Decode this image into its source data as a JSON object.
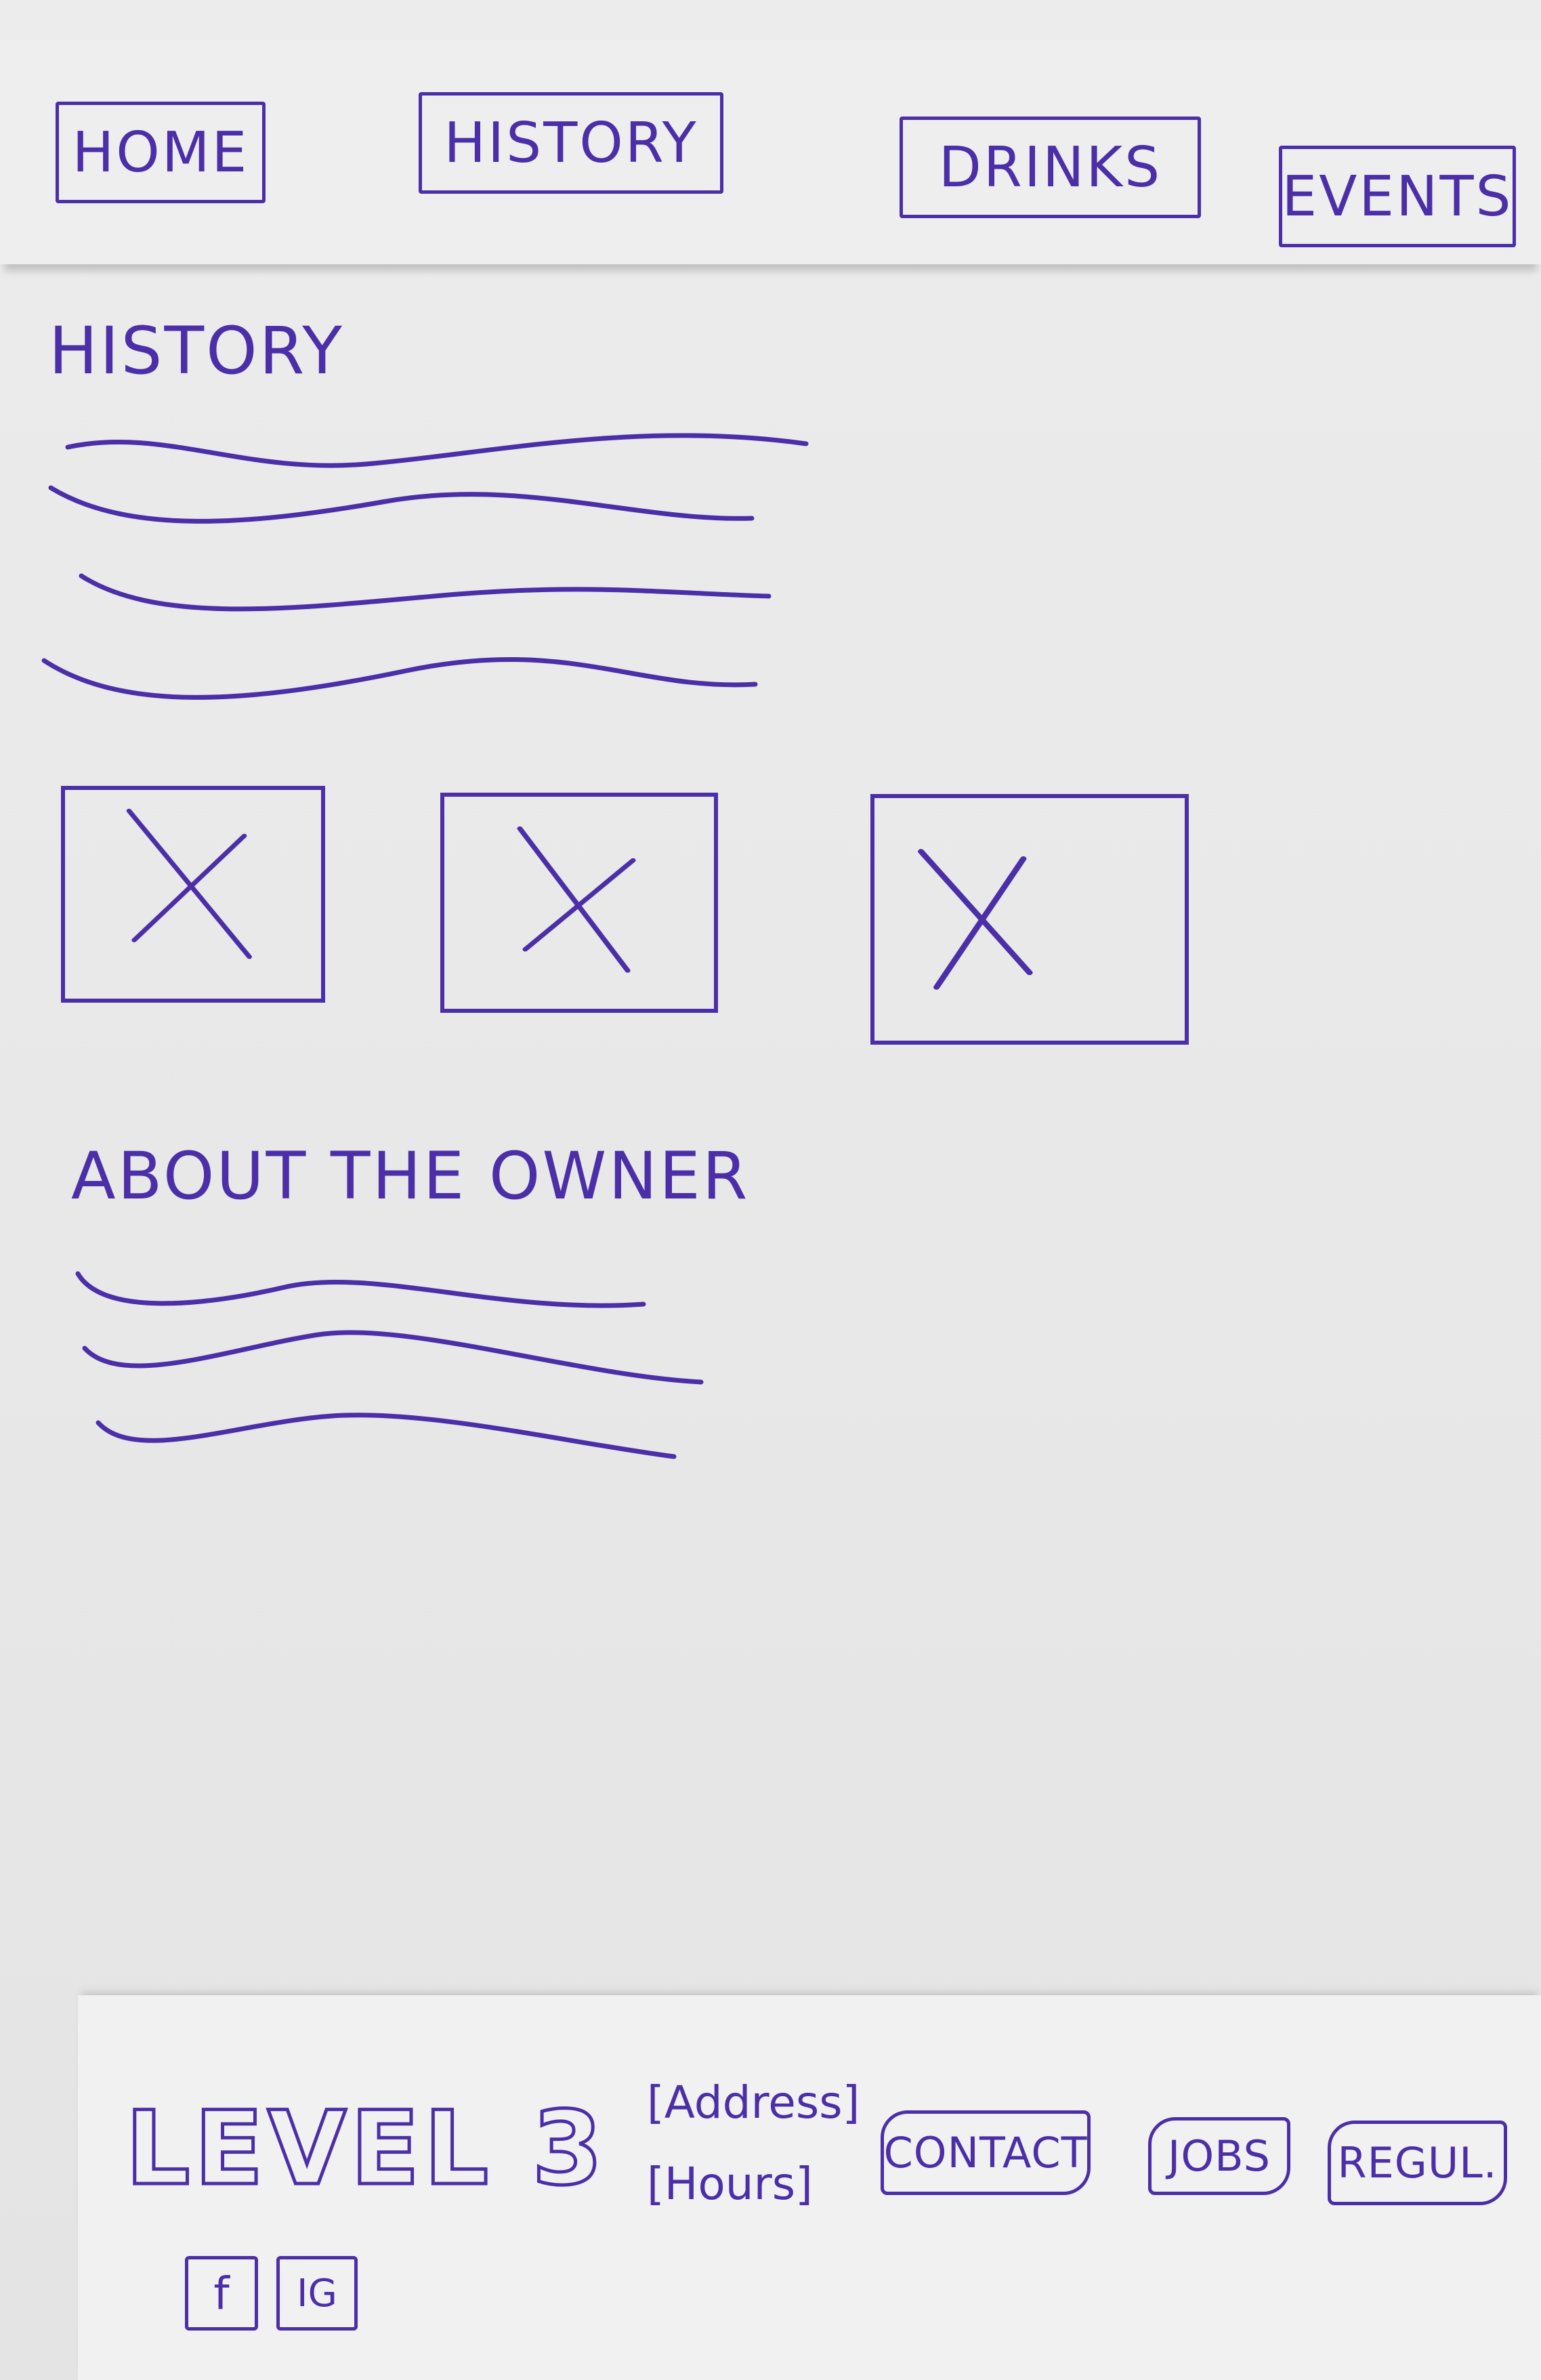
{
  "nav": {
    "items": [
      {
        "label": "HOME"
      },
      {
        "label": "HISTORY"
      },
      {
        "label": "DRINKS"
      },
      {
        "label": "EVENTS"
      }
    ]
  },
  "main": {
    "history_heading": "HISTORY",
    "about_heading": "ABOUT THE OWNER"
  },
  "footer": {
    "brand": "LEVEL 3",
    "address": "[Address]",
    "hours": "[Hours]",
    "links": [
      {
        "label": "CONTACT"
      },
      {
        "label": "JOBS"
      },
      {
        "label": "REGUL."
      }
    ],
    "social": [
      {
        "label": "f",
        "icon": "facebook-icon"
      },
      {
        "label": "IG",
        "icon": "instagram-icon"
      }
    ]
  },
  "colors": {
    "ink": "#4b2fa8",
    "paper": "#ececec"
  }
}
